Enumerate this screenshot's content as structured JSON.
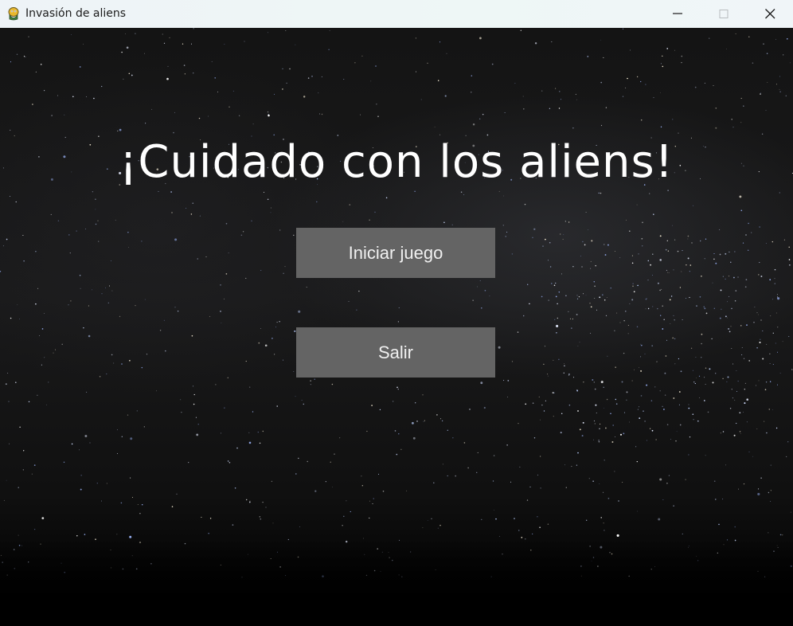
{
  "window": {
    "title": "Invasión de aliens",
    "app_icon": "pygame-snake-icon",
    "controls": {
      "minimize_icon": "minimize-icon",
      "maximize_icon": "maximize-icon",
      "close_icon": "close-icon"
    }
  },
  "game": {
    "background": "starry-night-sky",
    "heading": "¡Cuidado con los aliens!",
    "buttons": {
      "start_label": "Iniciar juego",
      "quit_label": "Salir"
    }
  },
  "colors": {
    "button_bg": "#646464",
    "button_text": "#f0f0f0",
    "heading": "#ffffff",
    "titlebar_bg": "#eef5f6"
  }
}
